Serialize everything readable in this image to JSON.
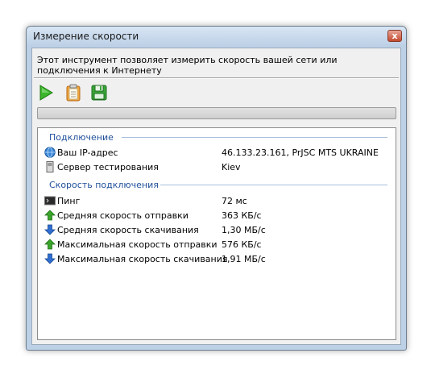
{
  "window": {
    "title": "Измерение скорости",
    "close_label": "x"
  },
  "description": "Этот инструмент позволяет измерить скорость вашей сети или подключения к Интернету",
  "toolbar": {
    "buttons": [
      {
        "name": "start",
        "icon": "play-icon"
      },
      {
        "name": "copy",
        "icon": "clipboard-icon"
      },
      {
        "name": "save",
        "icon": "floppy-disk-icon"
      }
    ]
  },
  "progress": {
    "fraction": 0
  },
  "sections": {
    "connection": {
      "title": "Подключение",
      "rows": [
        {
          "icon": "globe-icon",
          "label": "Ваш IP-адрес",
          "value": "46.133.23.161, PrJSC MTS UKRAINE"
        },
        {
          "icon": "server-icon",
          "label": "Сервер тестирования",
          "value": "Kiev"
        }
      ]
    },
    "speed": {
      "title": "Скорость подключения",
      "rows": [
        {
          "icon": "terminal-icon",
          "label": "Пинг",
          "value": "72 мс"
        },
        {
          "icon": "arrow-up-green-icon",
          "label": "Средняя скорость отправки",
          "value": "363 КБ/с"
        },
        {
          "icon": "arrow-down-blue-icon",
          "label": "Средняя скорость скачивания",
          "value": "1,30 МБ/с"
        },
        {
          "icon": "arrow-up-green-icon",
          "label": "Максимальная скорость отправки",
          "value": "576 КБ/с"
        },
        {
          "icon": "arrow-down-blue-icon",
          "label": "Максимальная скорость скачивания",
          "value": "1,91 МБ/с"
        }
      ]
    }
  },
  "colors": {
    "section_title": "#1e4f9a",
    "up_arrow": "#3aa52a",
    "down_arrow": "#2f6fd1"
  }
}
